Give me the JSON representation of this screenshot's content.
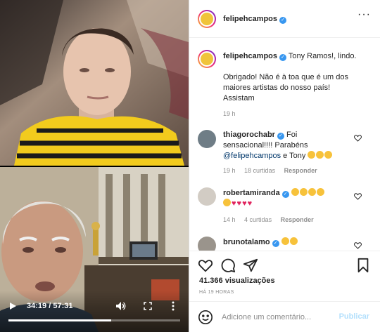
{
  "video": {
    "current_time": "34:19",
    "duration": "57:31",
    "progress": 0.597
  },
  "header": {
    "username": "felipehcampos"
  },
  "comments": [
    {
      "username": "felipehcampos",
      "text_lines": [
        "Tony Ramos!, lindo.",
        "",
        "Obrigado! Não é à toa que é um dos",
        "maiores artistas do nosso país!",
        "Assistam"
      ],
      "time": "19 h"
    },
    {
      "username": "thiagorochabr",
      "text_line1": "Foi",
      "text_line2": "sensacional!!!! Parabéns",
      "mention": "@felipehcampos",
      "text_after_mention": "e Tony",
      "emoji_count": 3,
      "time": "19 h",
      "likes": "18 curtidas",
      "reply": "Responder"
    },
    {
      "username": "robertamiranda",
      "emoji_claps": 4,
      "emoji_hearts": 4,
      "time": "14 h",
      "likes": "4 curtidas",
      "reply": "Responder"
    },
    {
      "username": "brunotalamo",
      "emoji_claps": 2
    }
  ],
  "stats": {
    "views": "41.366 visualizações",
    "posted_ago": "HÁ 19 HORAS"
  },
  "composer": {
    "placeholder": "Adicione um comentário...",
    "publish_label": "Publicar"
  },
  "icons": {
    "verified": "verified-badge-icon",
    "like": "heart-icon",
    "comment": "comment-bubble-icon",
    "share": "paper-plane-icon",
    "save": "bookmark-icon",
    "emoji": "smiley-icon",
    "play": "play-icon",
    "volume": "volume-icon",
    "fullscreen": "fullscreen-icon",
    "options": "kebab-icon"
  },
  "colors": {
    "verified": "#3897f0",
    "publish_disabled": "#b2dffc",
    "link": "#00376b",
    "muted": "#8e8e8e"
  }
}
